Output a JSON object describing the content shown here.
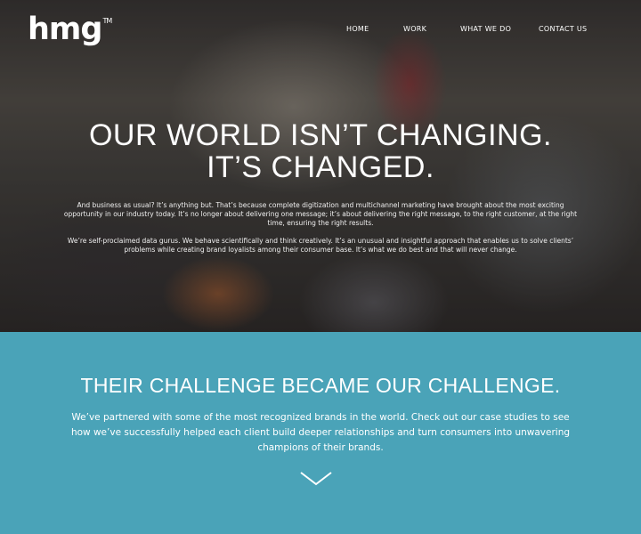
{
  "brand": {
    "logo": "hmg",
    "trademark": "TM"
  },
  "nav": {
    "items": [
      {
        "label": "HOME"
      },
      {
        "label": "WORK"
      },
      {
        "label": "WHAT WE DO"
      },
      {
        "label": "CONTACT US"
      }
    ]
  },
  "hero": {
    "headline_line1": "OUR WORLD ISN’T CHANGING.",
    "headline_line2": "IT’S CHANGED.",
    "paragraph1": "And business as usual? It’s anything but. That’s because complete digitization and multichannel marketing have brought about the most exciting opportunity in our industry today. It’s no longer about delivering one message; it’s about delivering the right message, to the right customer, at the right time, ensuring the right results.",
    "paragraph2": "We’re self-proclaimed data gurus. We behave scientifically and think creatively. It’s an unusual and insightful approach that enables us to solve clients’ problems while creating brand loyalists among their consumer base. It’s what we do best and that will never change."
  },
  "challenge": {
    "title": "THEIR CHALLENGE BECAME OUR CHALLENGE.",
    "text": "We’ve partnered with some of the most recognized brands in the world. Check out our case studies to see how we’ve successfully helped each client build deeper relationships and turn consumers into unwavering champions of their brands.",
    "scroll_icon": "chevron-down-icon"
  },
  "colors": {
    "band": "#4aa3b8",
    "text": "#ffffff"
  }
}
